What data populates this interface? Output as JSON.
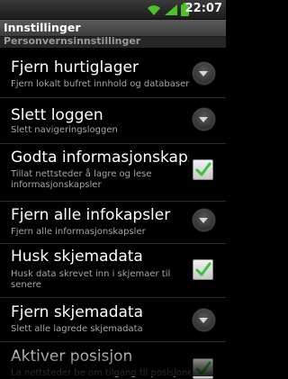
{
  "status_bar": {
    "time": "22:07"
  },
  "title_bar": {
    "title": "Innstillinger"
  },
  "section_header": "Personvernsinnstillinger",
  "settings": [
    {
      "title": "Fjern hurtiglager",
      "summary": "Fjern lokalt bufret innhold og databaser",
      "widget": "dropdown"
    },
    {
      "title": "Slett loggen",
      "summary": "Slett navigeringsloggen",
      "widget": "dropdown"
    },
    {
      "title": "Godta informasjonskapsler",
      "summary": "Tillat nettsteder å lagre og lese informasjonskapsler",
      "widget": "checkbox",
      "checked": true
    },
    {
      "title": "Fjern alle infokapsler",
      "summary": "Fjern alle informasjonskapsler",
      "widget": "dropdown"
    },
    {
      "title": "Husk skjemadata",
      "summary": "Husk data skrevet inn i skjemaer til senere",
      "widget": "checkbox",
      "checked": true
    },
    {
      "title": "Fjern skjemadata",
      "summary": "Slett alle lagrede skjemadata",
      "widget": "dropdown"
    },
    {
      "title": "Aktiver posisjon",
      "summary": "La nettsteder be om tilgang til posisjonen din",
      "widget": "checkbox",
      "checked": true
    }
  ],
  "accent_colors": {
    "check": "#3fbf3f",
    "title_bar": "#4a4a4a"
  }
}
